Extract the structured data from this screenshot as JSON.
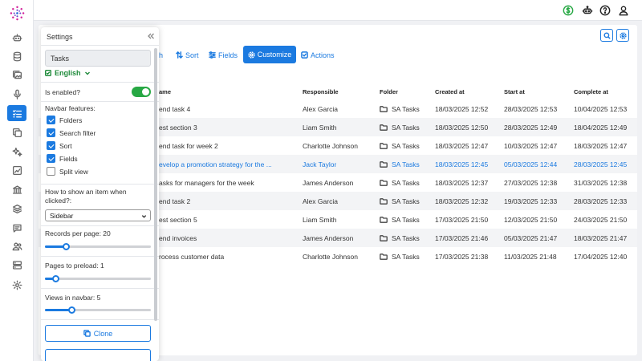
{
  "colors": {
    "accent": "#1b7ae0",
    "success": "#27a844",
    "language": "#1e8a3a"
  },
  "rail_icons": [
    "robot-icon",
    "database-icon",
    "gallery-icon",
    "microphone-icon",
    "tasks-list-icon",
    "copy-icon",
    "sparkles-icon",
    "chart-icon",
    "bank-icon",
    "layers-icon",
    "chat-icon",
    "users-icon",
    "server-icon",
    "gear-icon"
  ],
  "top_icons": [
    "dollar-icon",
    "robot-head-icon",
    "help-icon",
    "user-icon"
  ],
  "toolbar": {
    "search_partial": "h",
    "sort_label": "Sort",
    "fields_label": "Fields",
    "customize_label": "Customize",
    "actions_label": "Actions"
  },
  "table": {
    "headers": [
      "ame",
      "Responsible",
      "Folder",
      "Created at",
      "Start at",
      "Complete at"
    ],
    "rows": [
      [
        "end task 4",
        "Alex Garcia",
        "SA Tasks",
        "18/03/2025 12:52",
        "28/03/2025 12:53",
        "10/04/2025 12:53"
      ],
      [
        "est section 3",
        "Liam Smith",
        "SA Tasks",
        "18/03/2025 12:50",
        "28/03/2025 12:49",
        "18/04/2025 12:49"
      ],
      [
        "end task for week 2",
        "Charlotte Johnson",
        "SA Tasks",
        "18/03/2025 12:47",
        "10/03/2025 12:47",
        "18/03/2025 12:47"
      ],
      [
        "evelop a promotion strategy for the ...",
        "Jack Taylor",
        "SA Tasks",
        "18/03/2025 12:45",
        "05/03/2025 12:44",
        "28/03/2025 12:45"
      ],
      [
        "asks for managers for the week",
        "James Anderson",
        "SA Tasks",
        "18/03/2025 12:37",
        "27/03/2025 12:38",
        "31/03/2025 12:38"
      ],
      [
        "end task 2",
        "Alex Garcia",
        "SA Tasks",
        "18/03/2025 12:32",
        "19/03/2025 12:33",
        "28/03/2025 12:33"
      ],
      [
        "est section 5",
        "Liam Smith",
        "SA Tasks",
        "17/03/2025 21:50",
        "12/03/2025 21:50",
        "24/03/2025 21:50"
      ],
      [
        "end invoices",
        "James Anderson",
        "SA Tasks",
        "17/03/2025 21:46",
        "05/03/2025 21:47",
        "18/03/2025 21:47"
      ],
      [
        "rocess customer data",
        "Charlotte Johnson",
        "SA Tasks",
        "17/03/2025 21:38",
        "11/03/2025 21:48",
        "17/04/2025 12:40"
      ]
    ],
    "highlighted_row": 3
  },
  "settings": {
    "title": "Settings",
    "name_value": "Tasks",
    "language": "English",
    "enabled_label": "Is enabled?",
    "enabled": true,
    "navbar_label": "Navbar features:",
    "features": [
      {
        "label": "Folders",
        "checked": true
      },
      {
        "label": "Search filter",
        "checked": true
      },
      {
        "label": "Sort",
        "checked": true
      },
      {
        "label": "Fields",
        "checked": true
      },
      {
        "label": "Split view",
        "checked": false
      }
    ],
    "show_item_label": "How to show an item when clicked?:",
    "show_item_value": "Sidebar",
    "records_label": "Records per page: 20",
    "records_fraction": 0.2,
    "preload_label": "Pages to preload: 1",
    "preload_fraction": 0.1,
    "views_label": "Views in navbar: 5",
    "views_fraction": 0.25,
    "clone_label": "Clone"
  }
}
